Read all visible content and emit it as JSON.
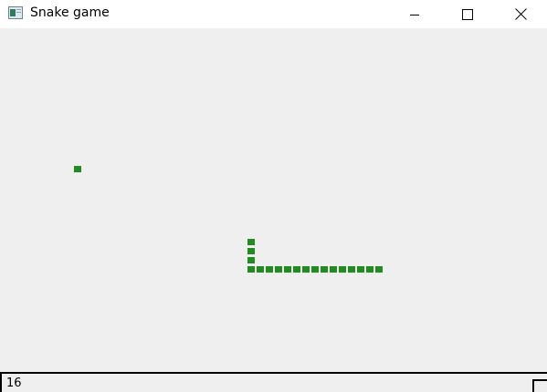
{
  "window": {
    "title": "Snake game",
    "app_icon": "window-app-icon",
    "controls": [
      "minimize-icon",
      "maximize-icon",
      "close-icon"
    ]
  },
  "game": {
    "snake_color": "#228b22",
    "food_color": "#228b22",
    "food": {
      "col": 8,
      "row": 15
    },
    "snake": [
      {
        "col": 27,
        "row": 23
      },
      {
        "col": 27,
        "row": 24
      },
      {
        "col": 27,
        "row": 25
      },
      {
        "col": 27,
        "row": 26
      },
      {
        "col": 28,
        "row": 26
      },
      {
        "col": 29,
        "row": 26
      },
      {
        "col": 30,
        "row": 26
      },
      {
        "col": 31,
        "row": 26
      },
      {
        "col": 32,
        "row": 26
      },
      {
        "col": 33,
        "row": 26
      },
      {
        "col": 34,
        "row": 26
      },
      {
        "col": 35,
        "row": 26
      },
      {
        "col": 36,
        "row": 26
      },
      {
        "col": 37,
        "row": 26
      },
      {
        "col": 38,
        "row": 26
      },
      {
        "col": 39,
        "row": 26
      },
      {
        "col": 40,
        "row": 26
      },
      {
        "col": 41,
        "row": 26
      }
    ]
  },
  "status": {
    "score": "16"
  }
}
